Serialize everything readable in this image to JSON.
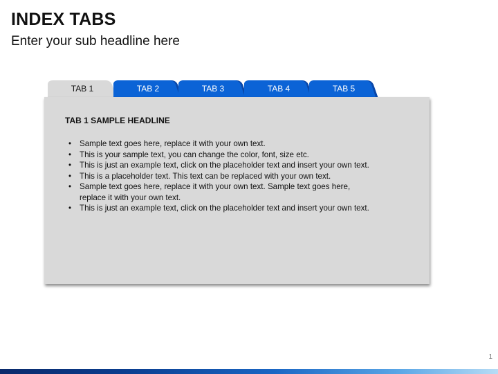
{
  "slide": {
    "title": "INDEX TABS",
    "subtitle": "Enter your sub headline here",
    "page_number": "1"
  },
  "tabs": [
    {
      "label": "TAB 1",
      "active": true
    },
    {
      "label": "TAB 2",
      "active": false
    },
    {
      "label": "TAB 3",
      "active": false
    },
    {
      "label": "TAB 4",
      "active": false
    },
    {
      "label": "TAB 5",
      "active": false
    }
  ],
  "panel": {
    "headline": "TAB 1 SAMPLE HEADLINE",
    "bullets": [
      "Sample text goes here, replace it with your own text.",
      "This is your sample text, you can change the color, font, size etc.",
      "This is just an example text, click on the placeholder text and insert your own text.",
      "This is a placeholder text. This text can be replaced with your own text.",
      "Sample text goes here, replace it with your own text. Sample text goes here, replace it with your own text.",
      "This is just an example text, click on the placeholder text and insert your own text."
    ]
  },
  "colors": {
    "tab_active": "#d9d9d9",
    "tab_inactive": "#0b63d6",
    "tab_inactive_dark": "#0a47a8",
    "panel": "#d9d9d9",
    "footer_dark": "#0a2a6b",
    "footer_light": "#b7dcf5"
  }
}
